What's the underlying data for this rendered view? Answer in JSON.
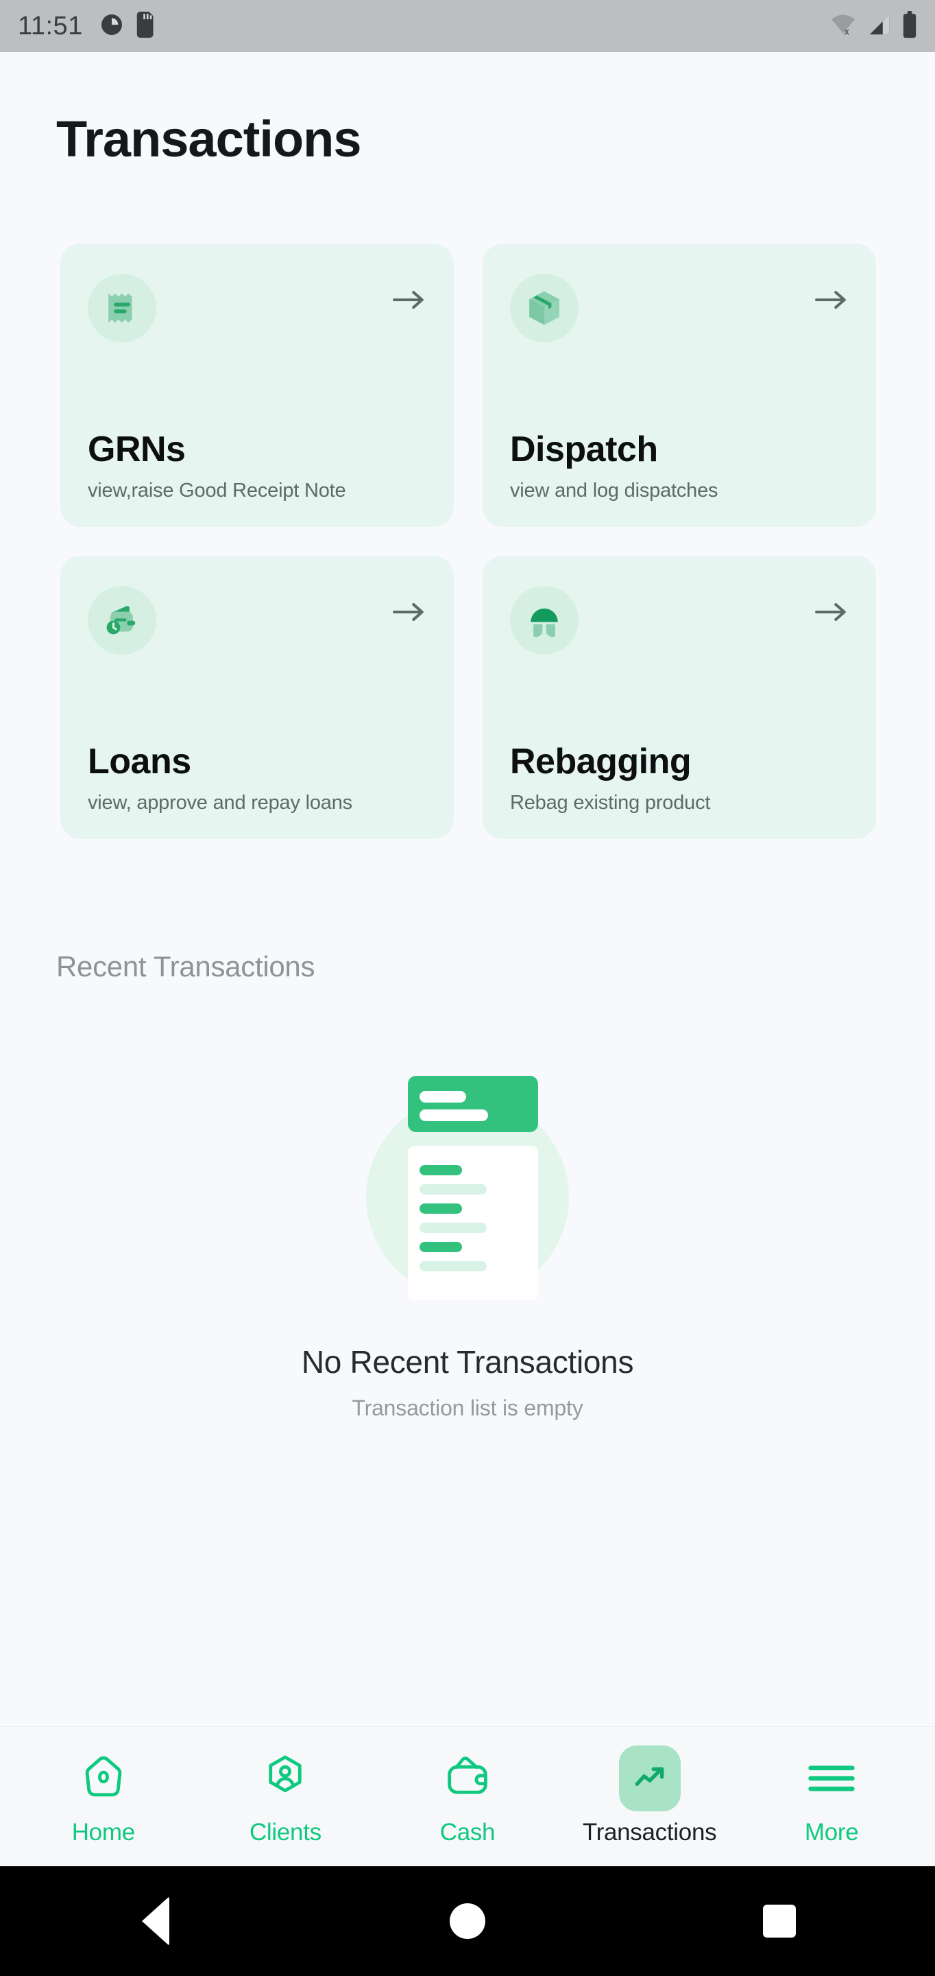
{
  "status_bar": {
    "time": "11:51",
    "left_icons": [
      "clock-icon",
      "sd-card-icon"
    ],
    "right_icons": [
      "wifi-off-icon",
      "cellular-signal-icon",
      "battery-icon"
    ]
  },
  "header": {
    "title": "Transactions"
  },
  "action_cards": [
    {
      "id": "grns",
      "title": "GRNs",
      "subtitle": "view,raise Good Receipt Note",
      "icon": "receipt-icon",
      "arrow": "arrow-right-icon"
    },
    {
      "id": "dispatch",
      "title": "Dispatch",
      "subtitle": "view and log dispatches",
      "icon": "package-box-icon",
      "arrow": "arrow-right-icon"
    },
    {
      "id": "loans",
      "title": "Loans",
      "subtitle": "view, approve and repay loans",
      "icon": "wallet-clock-icon",
      "arrow": "arrow-right-icon"
    },
    {
      "id": "rebagging",
      "title": "Rebagging",
      "subtitle": "Rebag existing product",
      "icon": "bag-dome-icon",
      "arrow": "arrow-right-icon"
    }
  ],
  "recent": {
    "section_title": "Recent Transactions",
    "empty_illustration": "empty-document-list-icon",
    "empty_title": "No Recent Transactions",
    "empty_subtitle": "Transaction list is empty"
  },
  "bottom_nav": {
    "items": [
      {
        "label": "Home",
        "icon": "home-icon",
        "active": false
      },
      {
        "label": "Clients",
        "icon": "user-hexagon-icon",
        "active": false
      },
      {
        "label": "Cash",
        "icon": "wallet-icon",
        "active": false
      },
      {
        "label": "Transactions",
        "icon": "trending-up-icon",
        "active": true
      },
      {
        "label": "More",
        "icon": "hamburger-menu-icon",
        "active": false
      }
    ]
  },
  "android_nav": {
    "back": "back-triangle-icon",
    "home": "home-circle-icon",
    "recents": "recents-square-icon"
  },
  "colors": {
    "page_background": "#f8f9fc",
    "card_background": "#e7f5f1",
    "icon_circle": "#d5efe2",
    "accent_green": "#0ec97f",
    "brand_green": "#2aa86a",
    "icon_green_light": "#8bcfae",
    "active_pill": "#a9e3c6",
    "title_dark": "#0c0e10",
    "muted_gray": "#8e9396",
    "status_bar": "#bcbec0"
  }
}
